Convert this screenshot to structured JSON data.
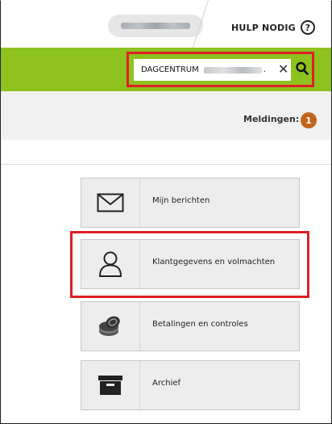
{
  "header": {
    "help_label": "HULP NODIG",
    "help_icon": "?"
  },
  "search": {
    "value_prefix": "DAGCENTRUM",
    "value_suffix": "."
  },
  "notifications": {
    "label": "Meldingen:",
    "count": "1"
  },
  "tiles": [
    {
      "label": "Mijn berichten",
      "icon": "envelope-icon"
    },
    {
      "label": "Klantgegevens en volmachten",
      "icon": "user-icon"
    },
    {
      "label": "Betalingen en controles",
      "icon": "coins-icon"
    },
    {
      "label": "Archief",
      "icon": "archive-box-icon"
    }
  ],
  "colors": {
    "brand_green": "#8dc21f",
    "highlight_red": "#e01f26",
    "badge_orange": "#c0641a"
  }
}
